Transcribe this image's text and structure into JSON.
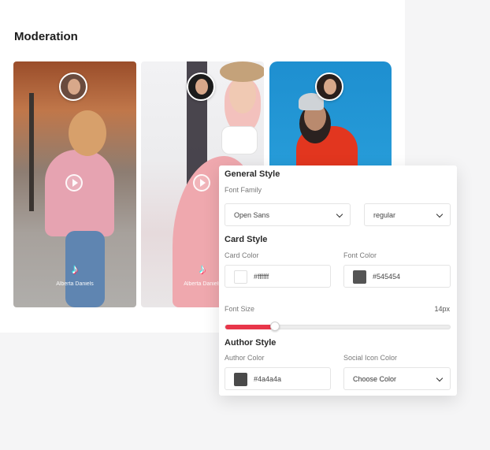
{
  "section": {
    "title": "Moderation"
  },
  "videos": [
    {
      "author": "Alberta Daniels",
      "platform_icon": "tiktok-icon",
      "play_icon": "play-icon"
    },
    {
      "author": "Alberta Daniels",
      "platform_icon": "tiktok-icon",
      "play_icon": "play-icon"
    },
    {
      "author": "",
      "platform_icon": "",
      "play_icon": ""
    }
  ],
  "settings": {
    "general_style": {
      "heading": "General Style",
      "font_family_label": "Font Family",
      "font_family_value": "Open Sans",
      "font_weight_value": "regular"
    },
    "card_style": {
      "heading": "Card Style",
      "card_color_label": "Card Color",
      "card_color_value": "#ffffff",
      "font_color_label": "Font Color",
      "font_color_value": "#545454"
    },
    "font_size": {
      "label": "Font Size",
      "value_text": "14px",
      "slider_fraction": 0.22
    },
    "author_style": {
      "heading": "Author Style",
      "author_color_label": "Author Color",
      "author_color_value": "#4a4a4a",
      "social_icon_color_label": "Social Icon Color",
      "social_icon_color_value": "Choose Color"
    }
  },
  "colors": {
    "accent": "#e8364a",
    "card_swatch": "#ffffff",
    "font_swatch": "#545454",
    "author_swatch": "#4a4a4a"
  }
}
